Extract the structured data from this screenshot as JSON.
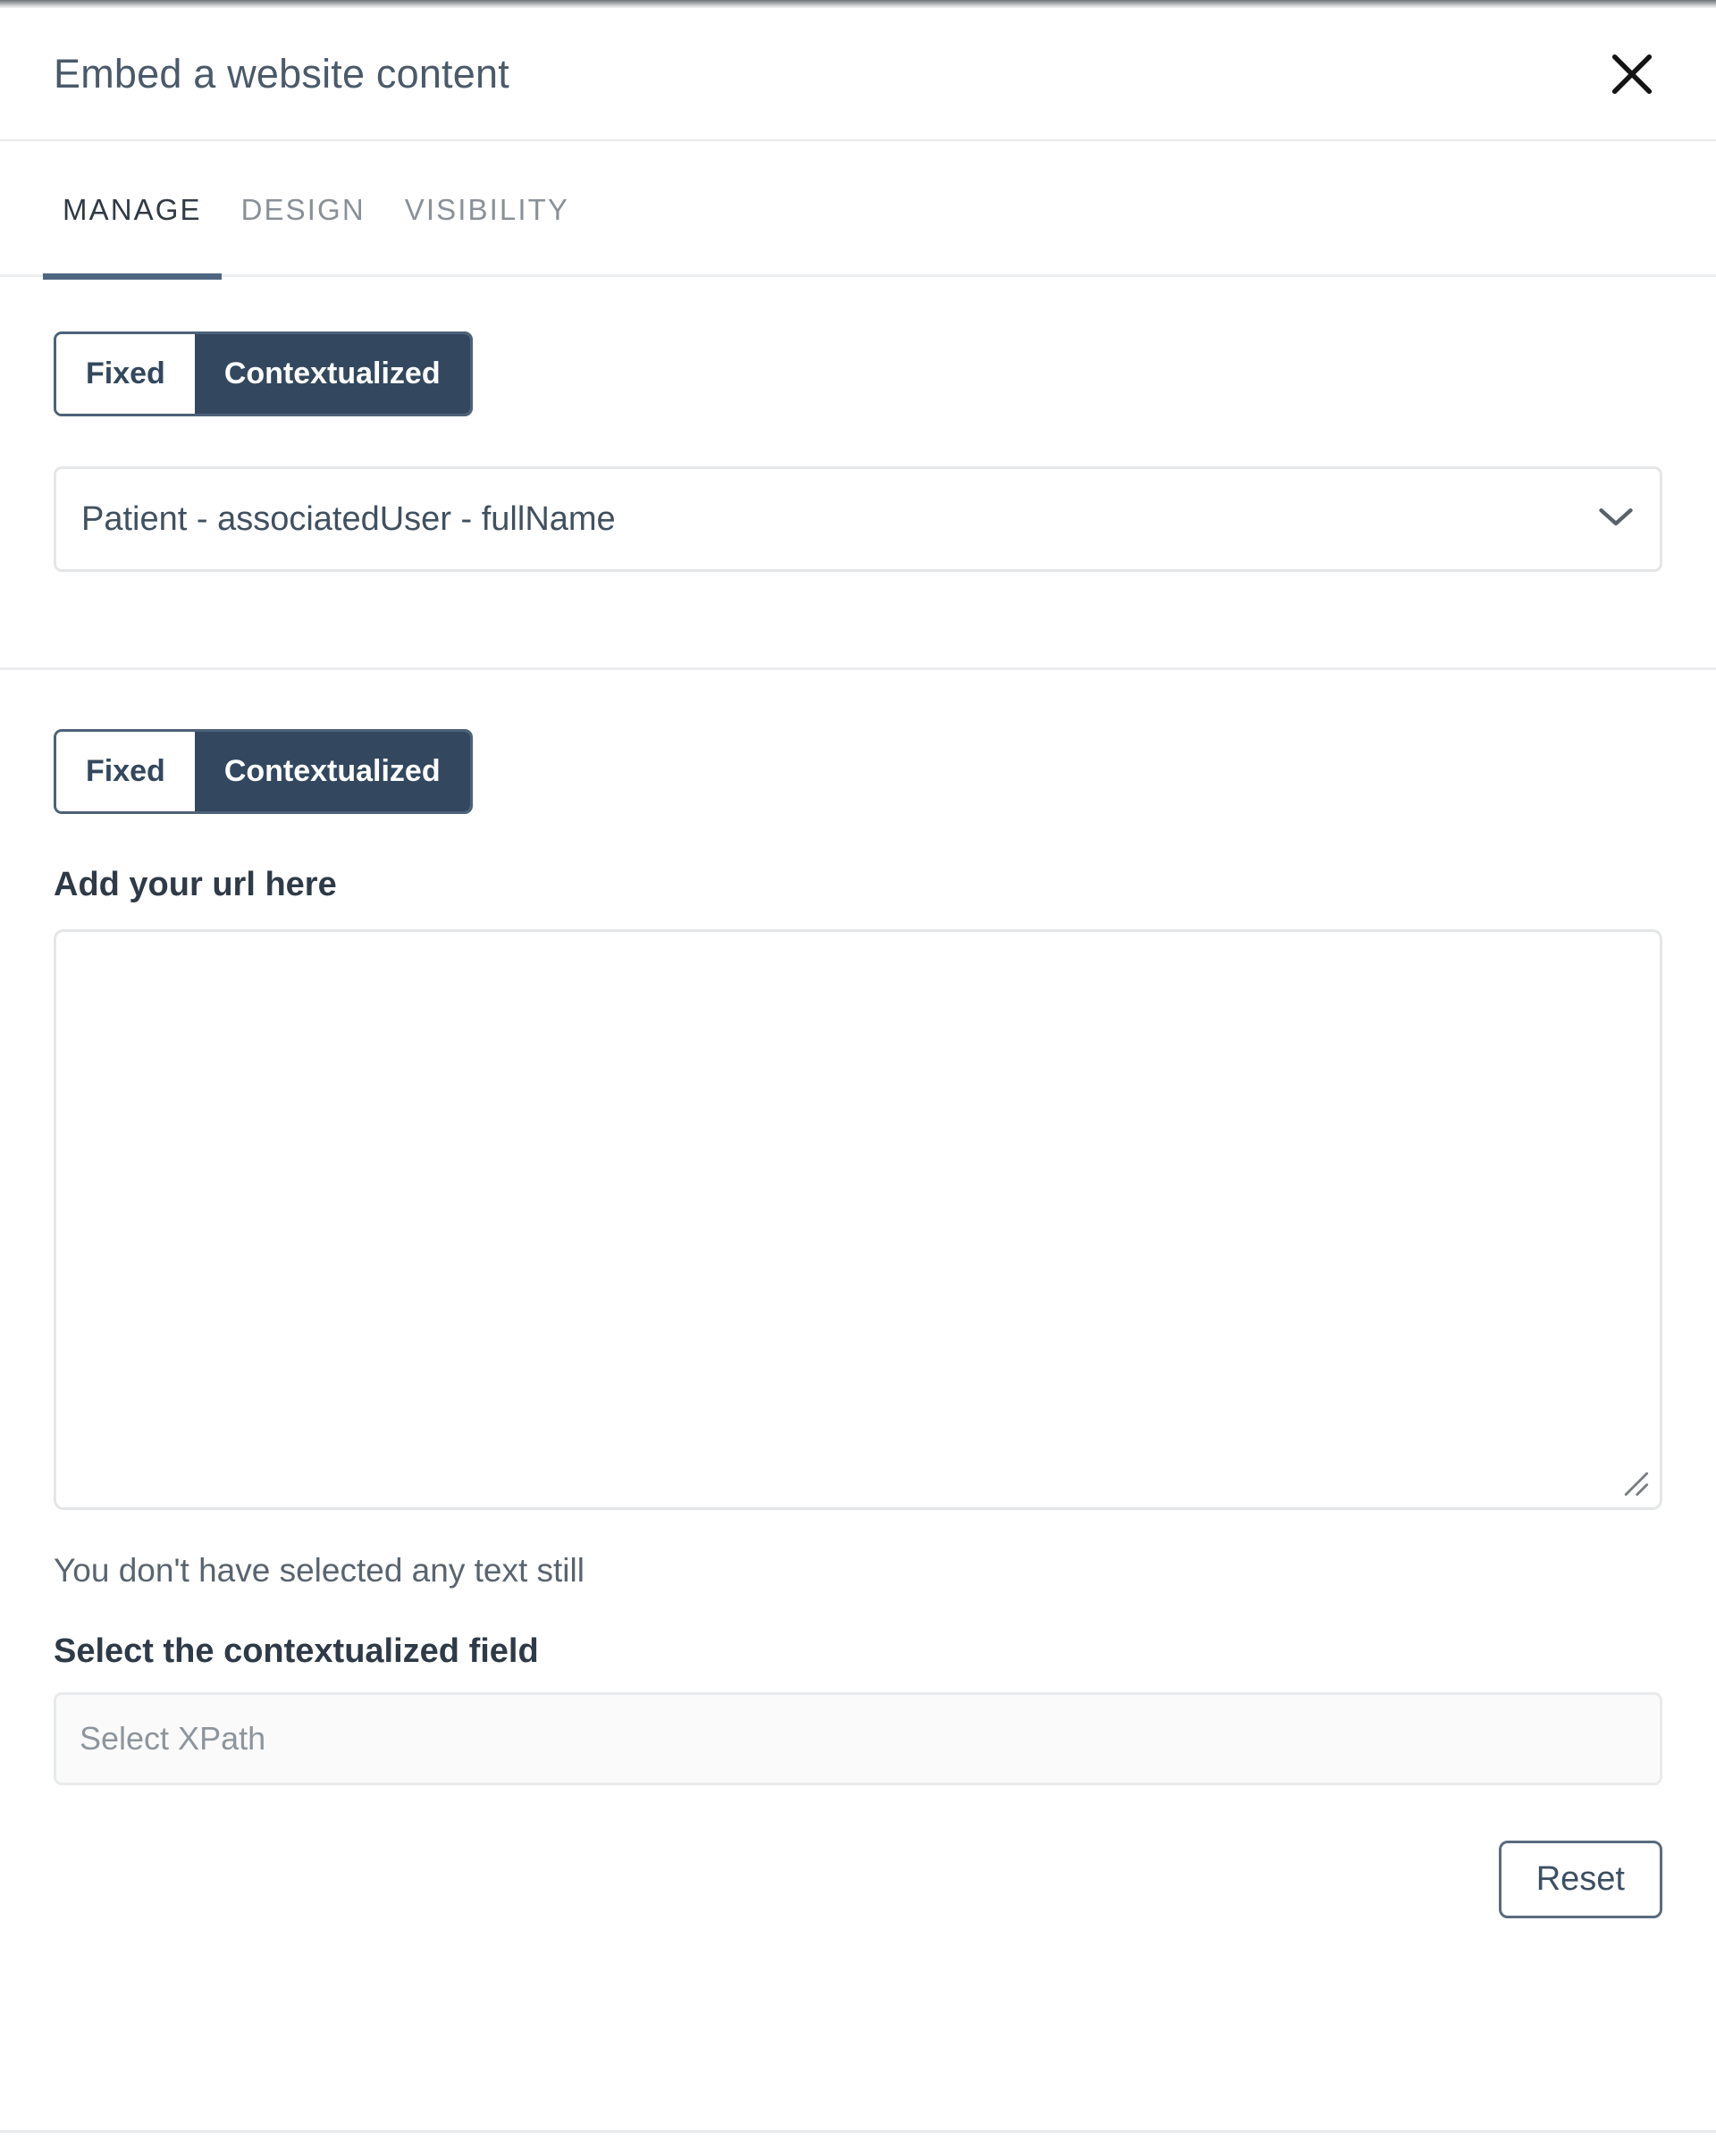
{
  "header": {
    "title": "Embed a website content",
    "close_icon": "close-icon"
  },
  "tabs": [
    {
      "label": "MANAGE",
      "active": true
    },
    {
      "label": "DESIGN",
      "active": false
    },
    {
      "label": "VISIBILITY",
      "active": false
    }
  ],
  "section_source": {
    "toggle": {
      "fixed_label": "Fixed",
      "contextualized_label": "Contextualized",
      "selected": "Contextualized"
    },
    "field_select": {
      "value": "Patient - associatedUser - fullName",
      "chevron_icon": "chevron-down-icon"
    }
  },
  "section_url": {
    "toggle": {
      "fixed_label": "Fixed",
      "contextualized_label": "Contextualized",
      "selected": "Contextualized"
    },
    "url_label": "Add your url here",
    "url_value": "",
    "url_placeholder": "",
    "status_text": "You don't have selected any text still",
    "xpath_label": "Select the contextualized field",
    "xpath_value": "",
    "xpath_placeholder": "Select XPath",
    "reset_label": "Reset"
  },
  "colors": {
    "accent_dark": "#33485e",
    "tab_underline": "#4e6781",
    "title_text": "#4a5a6a",
    "border_light": "#e4e6e8"
  }
}
